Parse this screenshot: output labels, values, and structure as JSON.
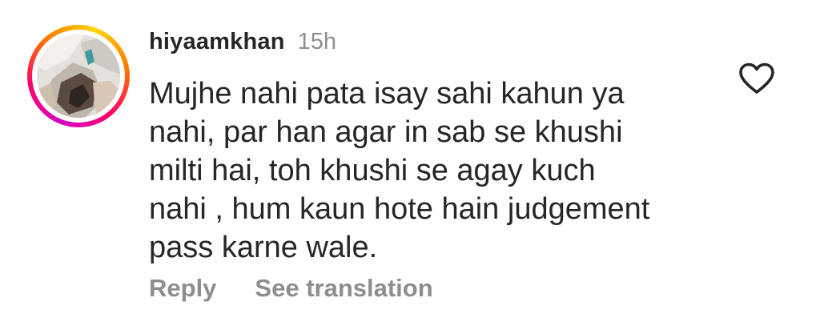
{
  "comment": {
    "username": "hiyaamkhan",
    "time_ago": "15h",
    "text_lines": [
      "Mujhe nahi pata isay sahi kahun ya",
      "nahi, par han agar in sab se khushi",
      "milti hai, toh khushi se agay kuch",
      "nahi , hum kaun hote hain judgement",
      "pass karne wale."
    ],
    "actions": {
      "reply_label": "Reply",
      "translate_label": "See translation"
    },
    "icons": {
      "like": "heart-outline-icon",
      "story_ring": "story-ring"
    }
  },
  "colors": {
    "text_primary": "#262626",
    "text_secondary": "#8e8e8e",
    "story_ring_start": "#d300c5",
    "story_ring_end": "#ffd600"
  }
}
